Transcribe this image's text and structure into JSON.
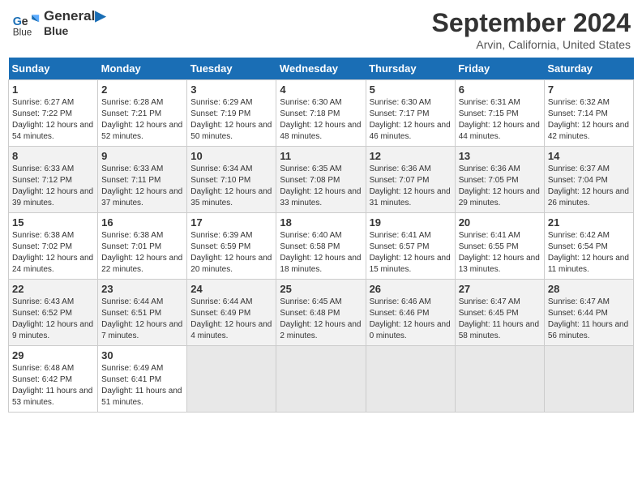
{
  "header": {
    "logo_line1": "General",
    "logo_line2": "Blue",
    "main_title": "September 2024",
    "subtitle": "Arvin, California, United States"
  },
  "days_of_week": [
    "Sunday",
    "Monday",
    "Tuesday",
    "Wednesday",
    "Thursday",
    "Friday",
    "Saturday"
  ],
  "weeks": [
    [
      {
        "num": "1",
        "sunrise": "Sunrise: 6:27 AM",
        "sunset": "Sunset: 7:22 PM",
        "daylight": "Daylight: 12 hours and 54 minutes."
      },
      {
        "num": "2",
        "sunrise": "Sunrise: 6:28 AM",
        "sunset": "Sunset: 7:21 PM",
        "daylight": "Daylight: 12 hours and 52 minutes."
      },
      {
        "num": "3",
        "sunrise": "Sunrise: 6:29 AM",
        "sunset": "Sunset: 7:19 PM",
        "daylight": "Daylight: 12 hours and 50 minutes."
      },
      {
        "num": "4",
        "sunrise": "Sunrise: 6:30 AM",
        "sunset": "Sunset: 7:18 PM",
        "daylight": "Daylight: 12 hours and 48 minutes."
      },
      {
        "num": "5",
        "sunrise": "Sunrise: 6:30 AM",
        "sunset": "Sunset: 7:17 PM",
        "daylight": "Daylight: 12 hours and 46 minutes."
      },
      {
        "num": "6",
        "sunrise": "Sunrise: 6:31 AM",
        "sunset": "Sunset: 7:15 PM",
        "daylight": "Daylight: 12 hours and 44 minutes."
      },
      {
        "num": "7",
        "sunrise": "Sunrise: 6:32 AM",
        "sunset": "Sunset: 7:14 PM",
        "daylight": "Daylight: 12 hours and 42 minutes."
      }
    ],
    [
      {
        "num": "8",
        "sunrise": "Sunrise: 6:33 AM",
        "sunset": "Sunset: 7:12 PM",
        "daylight": "Daylight: 12 hours and 39 minutes."
      },
      {
        "num": "9",
        "sunrise": "Sunrise: 6:33 AM",
        "sunset": "Sunset: 7:11 PM",
        "daylight": "Daylight: 12 hours and 37 minutes."
      },
      {
        "num": "10",
        "sunrise": "Sunrise: 6:34 AM",
        "sunset": "Sunset: 7:10 PM",
        "daylight": "Daylight: 12 hours and 35 minutes."
      },
      {
        "num": "11",
        "sunrise": "Sunrise: 6:35 AM",
        "sunset": "Sunset: 7:08 PM",
        "daylight": "Daylight: 12 hours and 33 minutes."
      },
      {
        "num": "12",
        "sunrise": "Sunrise: 6:36 AM",
        "sunset": "Sunset: 7:07 PM",
        "daylight": "Daylight: 12 hours and 31 minutes."
      },
      {
        "num": "13",
        "sunrise": "Sunrise: 6:36 AM",
        "sunset": "Sunset: 7:05 PM",
        "daylight": "Daylight: 12 hours and 29 minutes."
      },
      {
        "num": "14",
        "sunrise": "Sunrise: 6:37 AM",
        "sunset": "Sunset: 7:04 PM",
        "daylight": "Daylight: 12 hours and 26 minutes."
      }
    ],
    [
      {
        "num": "15",
        "sunrise": "Sunrise: 6:38 AM",
        "sunset": "Sunset: 7:02 PM",
        "daylight": "Daylight: 12 hours and 24 minutes."
      },
      {
        "num": "16",
        "sunrise": "Sunrise: 6:38 AM",
        "sunset": "Sunset: 7:01 PM",
        "daylight": "Daylight: 12 hours and 22 minutes."
      },
      {
        "num": "17",
        "sunrise": "Sunrise: 6:39 AM",
        "sunset": "Sunset: 6:59 PM",
        "daylight": "Daylight: 12 hours and 20 minutes."
      },
      {
        "num": "18",
        "sunrise": "Sunrise: 6:40 AM",
        "sunset": "Sunset: 6:58 PM",
        "daylight": "Daylight: 12 hours and 18 minutes."
      },
      {
        "num": "19",
        "sunrise": "Sunrise: 6:41 AM",
        "sunset": "Sunset: 6:57 PM",
        "daylight": "Daylight: 12 hours and 15 minutes."
      },
      {
        "num": "20",
        "sunrise": "Sunrise: 6:41 AM",
        "sunset": "Sunset: 6:55 PM",
        "daylight": "Daylight: 12 hours and 13 minutes."
      },
      {
        "num": "21",
        "sunrise": "Sunrise: 6:42 AM",
        "sunset": "Sunset: 6:54 PM",
        "daylight": "Daylight: 12 hours and 11 minutes."
      }
    ],
    [
      {
        "num": "22",
        "sunrise": "Sunrise: 6:43 AM",
        "sunset": "Sunset: 6:52 PM",
        "daylight": "Daylight: 12 hours and 9 minutes."
      },
      {
        "num": "23",
        "sunrise": "Sunrise: 6:44 AM",
        "sunset": "Sunset: 6:51 PM",
        "daylight": "Daylight: 12 hours and 7 minutes."
      },
      {
        "num": "24",
        "sunrise": "Sunrise: 6:44 AM",
        "sunset": "Sunset: 6:49 PM",
        "daylight": "Daylight: 12 hours and 4 minutes."
      },
      {
        "num": "25",
        "sunrise": "Sunrise: 6:45 AM",
        "sunset": "Sunset: 6:48 PM",
        "daylight": "Daylight: 12 hours and 2 minutes."
      },
      {
        "num": "26",
        "sunrise": "Sunrise: 6:46 AM",
        "sunset": "Sunset: 6:46 PM",
        "daylight": "Daylight: 12 hours and 0 minutes."
      },
      {
        "num": "27",
        "sunrise": "Sunrise: 6:47 AM",
        "sunset": "Sunset: 6:45 PM",
        "daylight": "Daylight: 11 hours and 58 minutes."
      },
      {
        "num": "28",
        "sunrise": "Sunrise: 6:47 AM",
        "sunset": "Sunset: 6:44 PM",
        "daylight": "Daylight: 11 hours and 56 minutes."
      }
    ],
    [
      {
        "num": "29",
        "sunrise": "Sunrise: 6:48 AM",
        "sunset": "Sunset: 6:42 PM",
        "daylight": "Daylight: 11 hours and 53 minutes."
      },
      {
        "num": "30",
        "sunrise": "Sunrise: 6:49 AM",
        "sunset": "Sunset: 6:41 PM",
        "daylight": "Daylight: 11 hours and 51 minutes."
      },
      null,
      null,
      null,
      null,
      null
    ]
  ]
}
